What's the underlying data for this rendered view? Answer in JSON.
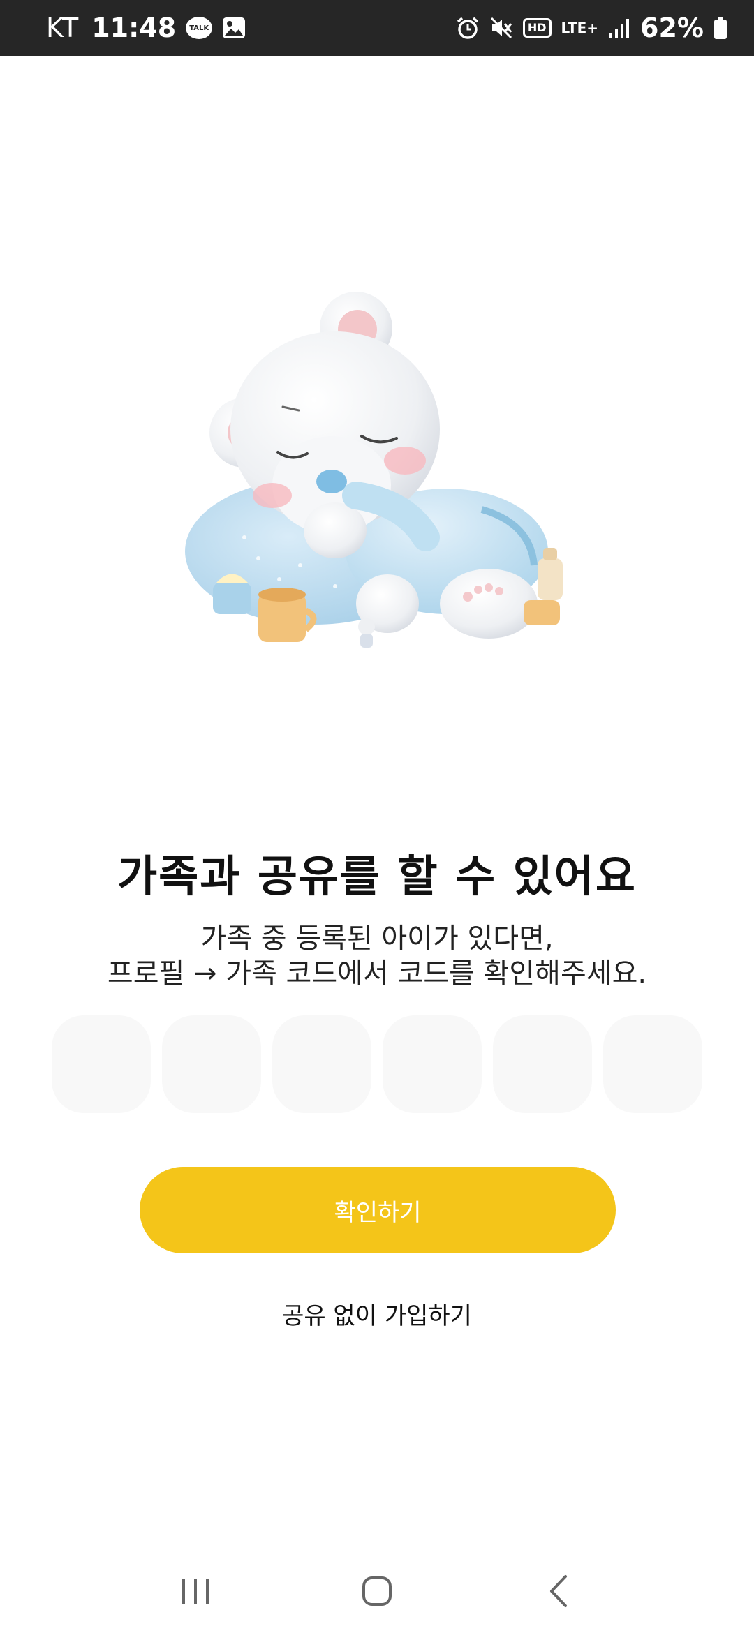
{
  "status_bar": {
    "carrier": "KT",
    "time": "11:48",
    "talk_label": "TALK",
    "hd_label": "HD",
    "network_label": "LTE+",
    "battery_percent": "62%",
    "icons": [
      "talk-icon",
      "gallery-icon",
      "alarm-icon",
      "mute-icon",
      "hd-voice-icon",
      "lte-icon",
      "signal-icon",
      "battery-icon"
    ]
  },
  "main": {
    "title": "가족과 공유를 할 수 있어요",
    "subtitle_line1": "가족 중 등록된 아이가 있다면,",
    "subtitle_line2": "프로필 → 가족 코드에서 코드를 확인해주세요.",
    "code_boxes": [
      "",
      "",
      "",
      "",
      "",
      ""
    ],
    "confirm_label": "확인하기",
    "skip_label": "공유 없이 가입하기"
  },
  "colors": {
    "accent": "#f4c519",
    "status_bar_bg": "#262626",
    "code_box_bg": "#f8f8f8"
  },
  "nav_bar": {
    "icons": [
      "recent-apps-icon",
      "home-icon",
      "back-icon"
    ]
  }
}
